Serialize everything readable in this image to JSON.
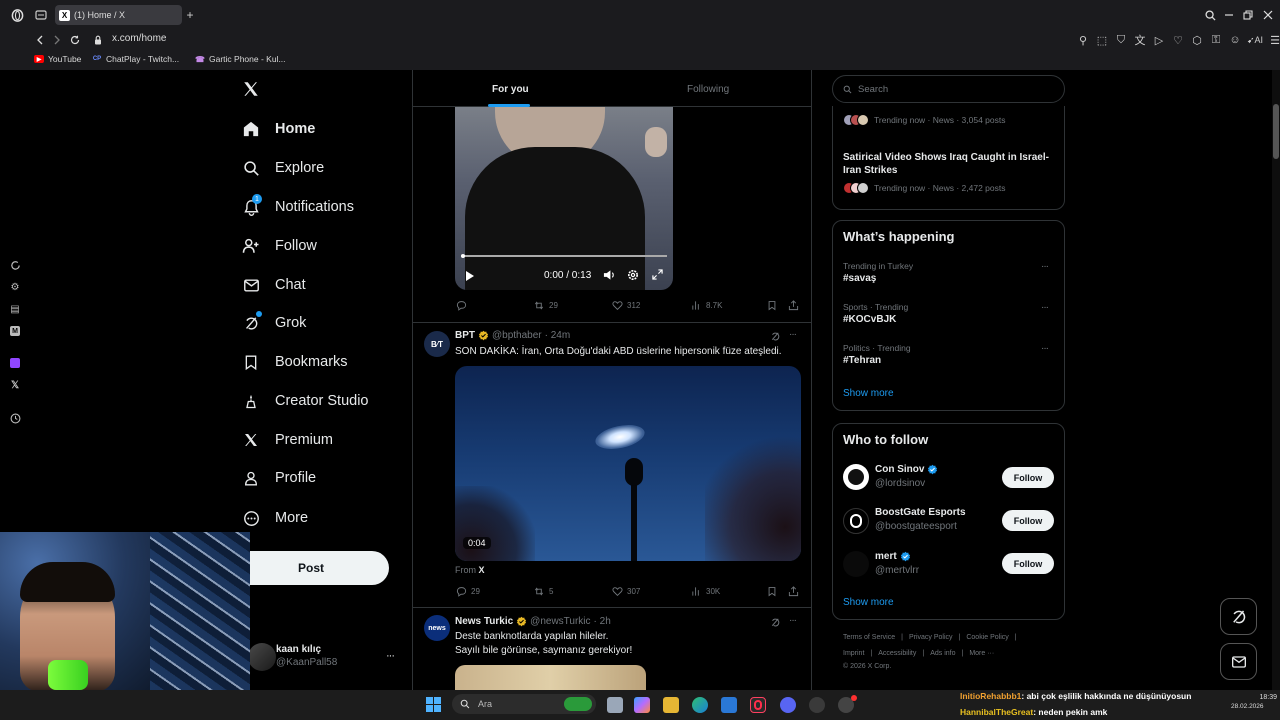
{
  "browser": {
    "tab_title": "(1) Home / X",
    "tab_favicon": "X",
    "url": "x.com/home",
    "ai_label": "AI",
    "bookmarks": [
      {
        "label": "YouTube",
        "icon_text": "▶",
        "color": "#ff0000"
      },
      {
        "label": "ChatPlay - Twitch...",
        "icon_text": "CP",
        "color": "#6b8cff"
      },
      {
        "label": "Gartic Phone - Kul...",
        "icon_text": "☎",
        "color": "#a46bd6"
      }
    ]
  },
  "nav": {
    "items": [
      {
        "label": "Home",
        "icon": "home-icon"
      },
      {
        "label": "Explore",
        "icon": "search-icon"
      },
      {
        "label": "Notifications",
        "icon": "bell-icon",
        "badge": "1"
      },
      {
        "label": "Follow",
        "icon": "person-add-icon"
      },
      {
        "label": "Chat",
        "icon": "mail-icon"
      },
      {
        "label": "Grok",
        "icon": "grok-icon"
      },
      {
        "label": "Bookmarks",
        "icon": "bookmark-icon"
      },
      {
        "label": "Creator Studio",
        "icon": "creator-icon"
      },
      {
        "label": "Premium",
        "icon": "x-logo-icon"
      },
      {
        "label": "Profile",
        "icon": "person-icon"
      },
      {
        "label": "More",
        "icon": "more-circle-icon"
      }
    ],
    "post_label": "Post",
    "account": {
      "name": "kaan kılıç",
      "handle": "@KaanPall58"
    }
  },
  "timeline": {
    "tabs": [
      {
        "label": "For you"
      },
      {
        "label": "Following"
      }
    ],
    "post1": {
      "video_time": "0:00 / 0:13",
      "replies": "",
      "reposts": "29",
      "likes": "312",
      "views": "8.7K"
    },
    "post2": {
      "name": "BPT",
      "handle": "@bpthaber",
      "time": "· 24m",
      "text": "SON DAKİKA: İran, Orta Doğu'daki ABD üslerine hipersonik füze ateşledi.",
      "duration": "0:04",
      "from_label": "From",
      "from_source": "X",
      "replies": "29",
      "reposts": "5",
      "likes": "307",
      "views": "30K"
    },
    "post3": {
      "name": "News Turkic",
      "handle": "@newsTurkic",
      "time": "· 2h",
      "line1": "Deste banknotlarda yapılan hileler.",
      "line2": "Sayılı bile görünse, saymanız gerekiyor!",
      "avatar_text": "news"
    }
  },
  "right": {
    "search_placeholder": "Search",
    "trend_top": [
      {
        "meta": "Trending now · News · 3,054 posts"
      },
      {
        "title": "Satirical Video Shows Iraq Caught in Israel-Iran Strikes",
        "meta": "Trending now · News · 2,472 posts"
      }
    ],
    "happening": {
      "title": "What’s happening",
      "items": [
        {
          "context": "Trending in Turkey",
          "tag": "#savaş"
        },
        {
          "context": "Sports · Trending",
          "tag": "#KOCvBJK"
        },
        {
          "context": "Politics · Trending",
          "tag": "#Tehran"
        }
      ],
      "show_more": "Show more"
    },
    "who_to_follow": {
      "title": "Who to follow",
      "users": [
        {
          "name": "Con Sinov",
          "handle": "@lordsinov",
          "verified": true
        },
        {
          "name": "BoostGate Esports",
          "handle": "@boostgateesport",
          "verified": false
        },
        {
          "name": "mert",
          "handle": "@mertvlrr",
          "verified": true
        }
      ],
      "follow_label": "Follow",
      "show_more": "Show more"
    },
    "footer": {
      "row1": [
        "Terms of Service",
        "|",
        "Privacy Policy",
        "|",
        "Cookie Policy",
        "|"
      ],
      "row2": [
        "Imprint",
        "|",
        "Accessibility",
        "|",
        "Ads info",
        "|",
        "More ···"
      ],
      "copyright": "© 2026 X Corp."
    }
  },
  "taskbar": {
    "search_placeholder": "Ara",
    "time": "18:39",
    "date": "28.02.2026"
  },
  "chat_overlay": [
    {
      "user": "InitioRehabbb1",
      "message": ": abi çok eşlilik hakkında ne düşünüyosun",
      "color": "#f0a030"
    },
    {
      "user": "HannibalTheGreat",
      "message": ": neden pekin amk",
      "color": "#e8c020"
    }
  ],
  "colors": {
    "accent": "#1d9bf0",
    "background": "#000000",
    "text": "#e7e9ea",
    "muted": "#71767b",
    "border": "#2f3336"
  }
}
